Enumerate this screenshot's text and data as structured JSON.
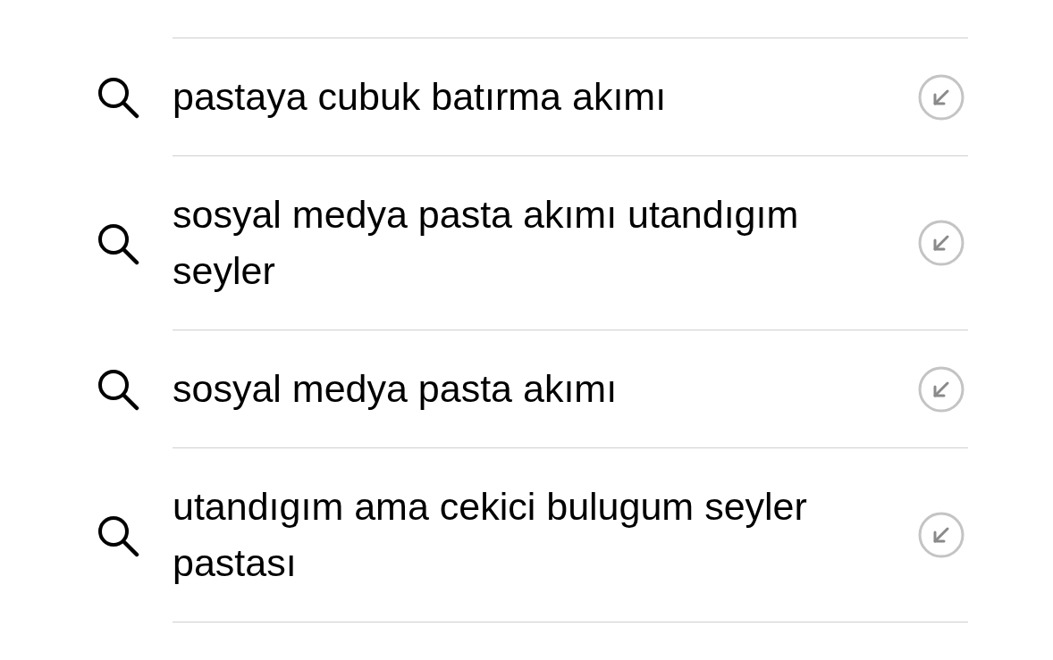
{
  "suggestions": [
    {
      "text": "pastaya cubuk batırma akımı"
    },
    {
      "text": "sosyal medya pasta akımı utandıgım seyler"
    },
    {
      "text": "sosyal medya pasta akımı"
    },
    {
      "text": "utandıgım ama cekici bulugum seyler pastası"
    }
  ]
}
